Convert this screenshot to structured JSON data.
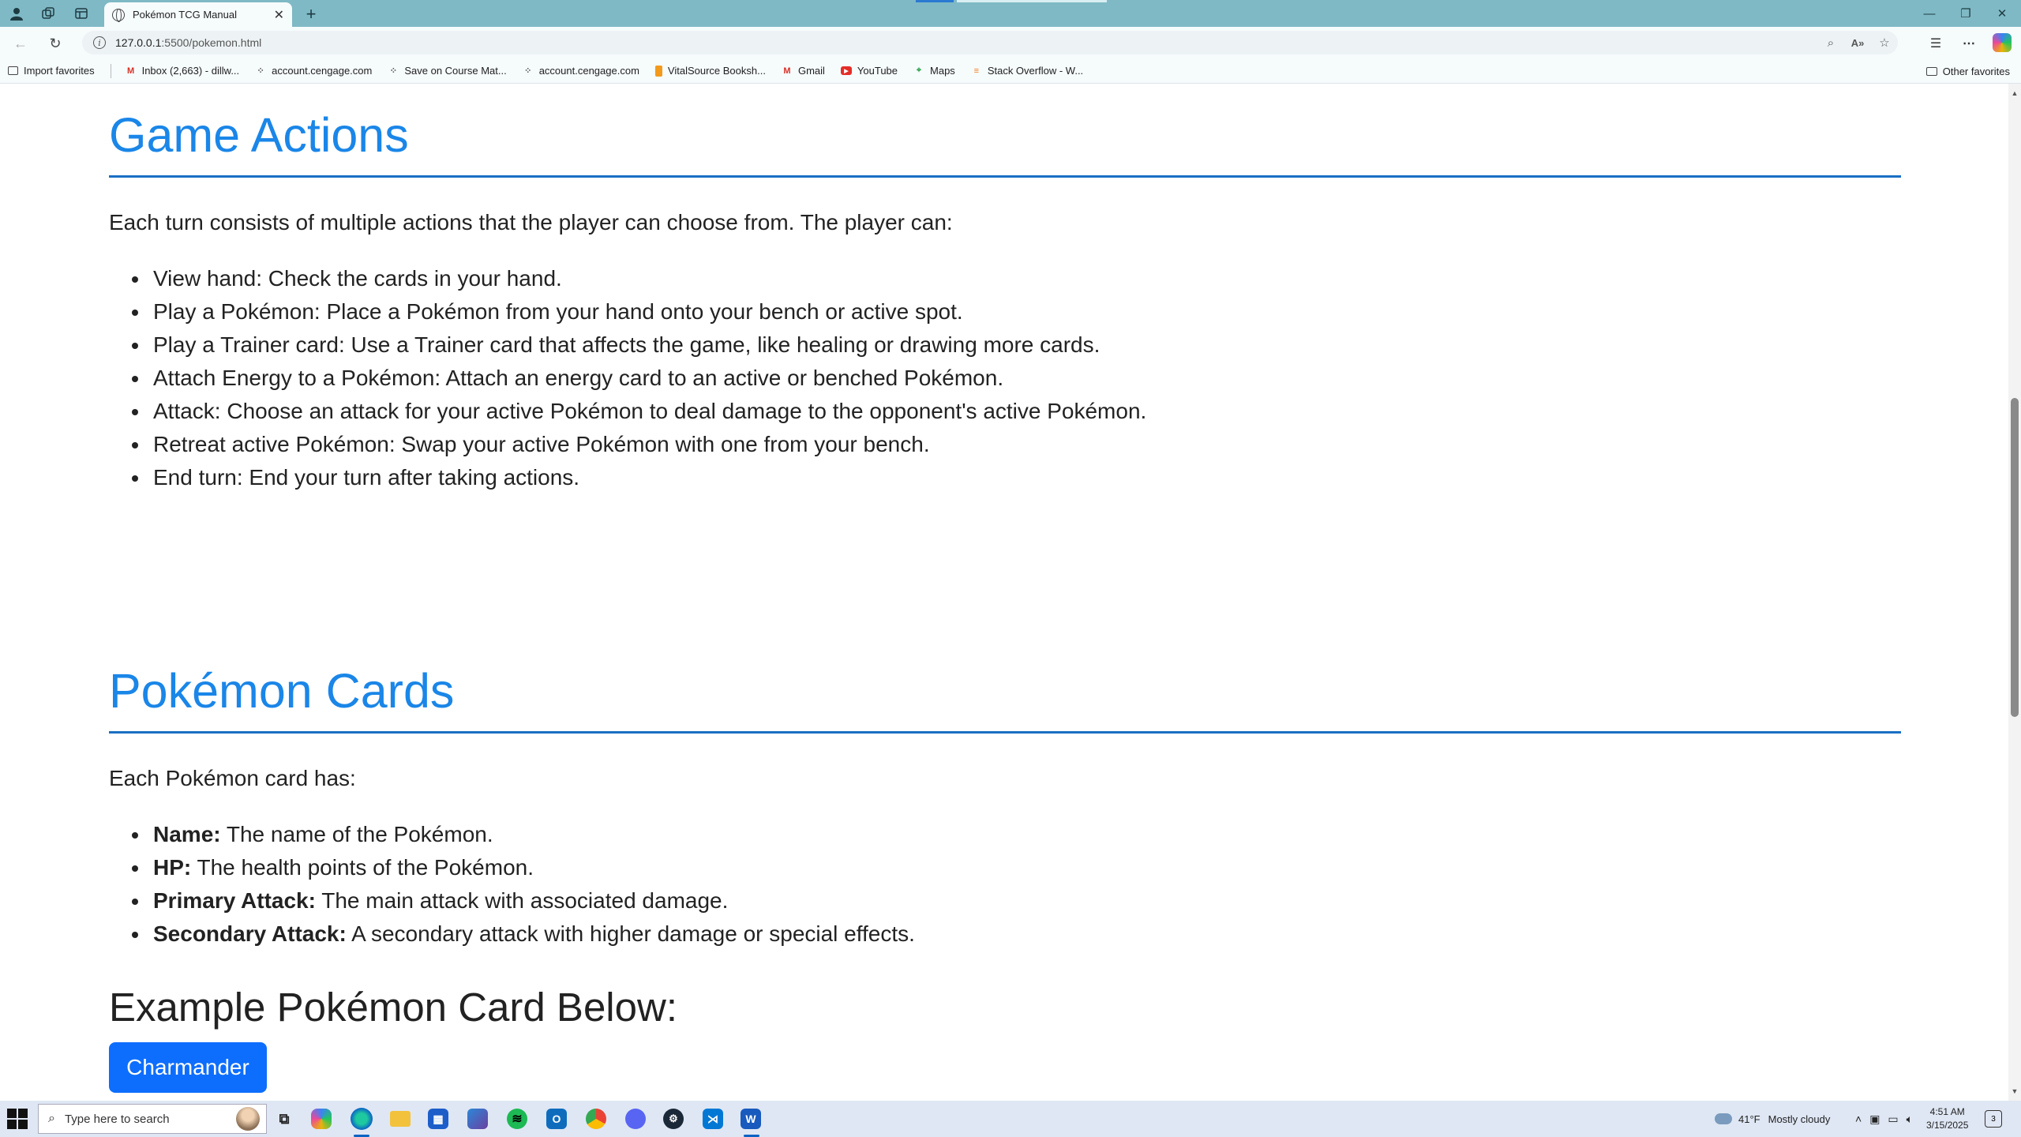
{
  "browser": {
    "tab_title": "Pokémon TCG Manual",
    "url_host": "127.0.0.1",
    "url_path": ":5500/pokemon.html",
    "favorites": [
      {
        "label": "Import favorites",
        "icon": "import-icon"
      },
      {
        "label": "Inbox (2,663) - dillw...",
        "icon": "gmail-icon"
      },
      {
        "label": "account.cengage.com",
        "icon": "page-icon"
      },
      {
        "label": "Save on Course Mat...",
        "icon": "page-icon"
      },
      {
        "label": "account.cengage.com",
        "icon": "page-icon"
      },
      {
        "label": "VitalSource Booksh...",
        "icon": "vitalsource-icon"
      },
      {
        "label": "Gmail",
        "icon": "gmail-icon"
      },
      {
        "label": "YouTube",
        "icon": "youtube-icon"
      },
      {
        "label": "Maps",
        "icon": "maps-icon"
      },
      {
        "label": "Stack Overflow - W...",
        "icon": "stackoverflow-icon"
      }
    ],
    "other_favorites": "Other favorites"
  },
  "page": {
    "game_actions": {
      "heading": "Game Actions",
      "intro": "Each turn consists of multiple actions that the player can choose from. The player can:",
      "items": [
        "View hand: Check the cards in your hand.",
        "Play a Pokémon: Place a Pokémon from your hand onto your bench or active spot.",
        "Play a Trainer card: Use a Trainer card that affects the game, like healing or drawing more cards.",
        "Attach Energy to a Pokémon: Attach an energy card to an active or benched Pokémon.",
        "Attack: Choose an attack for your active Pokémon to deal damage to the opponent's active Pokémon.",
        "Retreat active Pokémon: Swap your active Pokémon with one from your bench.",
        "End turn: End your turn after taking actions."
      ]
    },
    "pokemon_cards": {
      "heading": "Pokémon Cards",
      "intro": "Each Pokémon card has:",
      "items": [
        {
          "term": "Name:",
          "desc": " The name of the Pokémon."
        },
        {
          "term": "HP:",
          "desc": " The health points of the Pokémon."
        },
        {
          "term": "Primary Attack:",
          "desc": " The main attack with associated damage."
        },
        {
          "term": "Secondary Attack:",
          "desc": " A secondary attack with higher damage or special effects."
        }
      ],
      "example_heading": "Example Pokémon Card Below:",
      "example_button": "Charmander"
    }
  },
  "taskbar": {
    "search_placeholder": "Type here to search",
    "weather_temp": "41°F",
    "weather_desc": "Mostly cloudy",
    "time": "4:51 AM",
    "date": "3/15/2025",
    "notification_count": "3"
  },
  "colors": {
    "heading_blue": "#1a86e8",
    "rule_blue": "#1a6fc4",
    "button_blue": "#0d6efd",
    "tabstrip": "#7fb9c5"
  }
}
